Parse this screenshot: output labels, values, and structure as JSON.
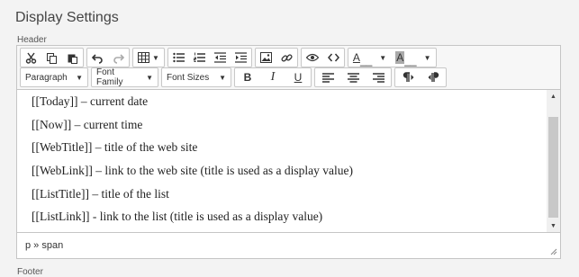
{
  "section": {
    "title": "Display Settings"
  },
  "header_label": "Header",
  "footer_label": "Footer",
  "toolbar": {
    "text_color_letter": "A",
    "bg_color_letter": "A",
    "bold": "B",
    "italic": "I",
    "underline": "U",
    "format_select": "Paragraph",
    "font_family_select": "Font Family",
    "font_size_select": "Font Sizes"
  },
  "content": {
    "lines": [
      "[[Today]] – current date",
      "[[Now]] – current time",
      "[[WebTitle]] – title of the web site",
      "[[WebLink]] – link to the web site (title is used as a display value)",
      "[[ListTitle]] – title of the list",
      "[[ListLink]] - link to the list (title is used as a display value)"
    ]
  },
  "statusbar": {
    "path": "p » span"
  }
}
